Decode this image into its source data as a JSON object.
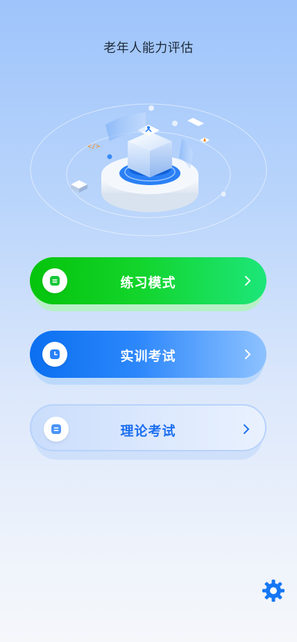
{
  "header": {
    "title": "老年人能力评估"
  },
  "menu": [
    {
      "label": "练习模式",
      "icon": "document-icon",
      "color": "#05c40b"
    },
    {
      "label": "实训考试",
      "icon": "clock-icon",
      "color": "#0a6ff0"
    },
    {
      "label": "理论考试",
      "icon": "document-icon",
      "color": "#1d6ff0"
    }
  ],
  "settings": {
    "icon": "gear-icon",
    "color": "#1677f5"
  }
}
